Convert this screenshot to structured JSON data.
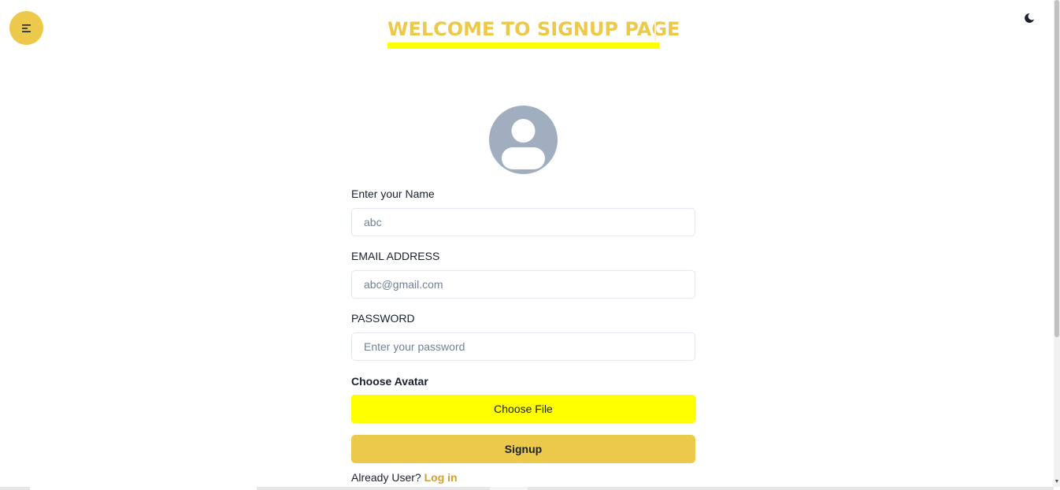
{
  "header": {
    "title": "WELCOME TO SIGNUP PAGE",
    "menu_icon": "menu-left-align-icon",
    "theme_icon": "moon-icon"
  },
  "avatar": {
    "icon": "user-placeholder-icon"
  },
  "form": {
    "name_label": "Enter your Name",
    "name_placeholder": "abc",
    "email_label": "EMAIL ADDRESS",
    "email_placeholder": "abc@gmail.com",
    "password_label": "PASSWORD",
    "password_placeholder": "Enter your password",
    "avatar_label": "Choose Avatar",
    "choose_file_label": "Choose File",
    "signup_label": "Signup",
    "already_text": "Already User?",
    "login_label": "Log in"
  },
  "colors": {
    "accent": "#ecc94b",
    "highlight": "#ffff00",
    "link": "#d69e2e",
    "avatar_bg": "#a0aec0"
  }
}
